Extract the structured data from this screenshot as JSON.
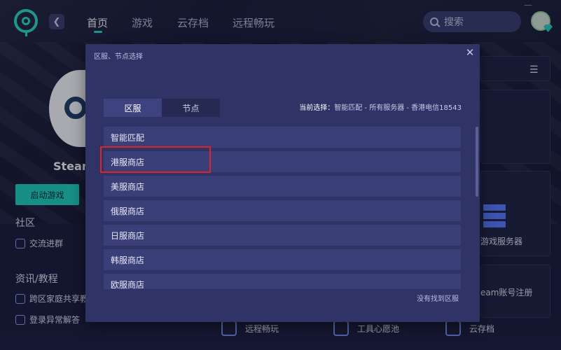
{
  "nav": {
    "tabs": [
      {
        "label": "首页",
        "active": true
      },
      {
        "label": "游戏",
        "active": false
      },
      {
        "label": "云存档",
        "active": false
      },
      {
        "label": "远程畅玩",
        "active": false
      }
    ],
    "search_placeholder": "搜索",
    "window_controls": [
      "—"
    ]
  },
  "game": {
    "title": "Steam",
    "launch_button": "启动游戏"
  },
  "sidebar": {
    "community_heading": "社区",
    "community_items": [
      "交流进群"
    ],
    "news_heading": "资讯/教程",
    "news_items": [
      "跨区家庭共享教",
      "登录异常解答"
    ]
  },
  "right_panel": {
    "server_label": "游戏服务器",
    "steam_register": "eam账号注册"
  },
  "bottom_tools": [
    {
      "icon": "remote-play-icon",
      "label": "远程畅玩"
    },
    {
      "icon": "wishlist-icon",
      "label": "工具心愿池"
    },
    {
      "icon": "cloud-save-icon",
      "label": "云存档"
    }
  ],
  "dialog": {
    "title": "区服、节点选择",
    "tabs": [
      {
        "label": "区服",
        "active": true
      },
      {
        "label": "节点",
        "active": false
      }
    ],
    "current_selection_label": "当前选择：",
    "current_selection_value": "智能匹配 - 所有服务器 - 香港电信18543",
    "regions": [
      "智能匹配",
      "港服商店",
      "美服商店",
      "俄服商店",
      "日服商店",
      "韩服商店",
      "欧服商店"
    ],
    "highlighted_index": 1,
    "not_found_link": "没有找到区服"
  },
  "colors": {
    "accent": "#1fd5bf",
    "dialog_bg": "#2f3365",
    "item_bg": "#3b3f78",
    "highlight": "#e0222a"
  }
}
